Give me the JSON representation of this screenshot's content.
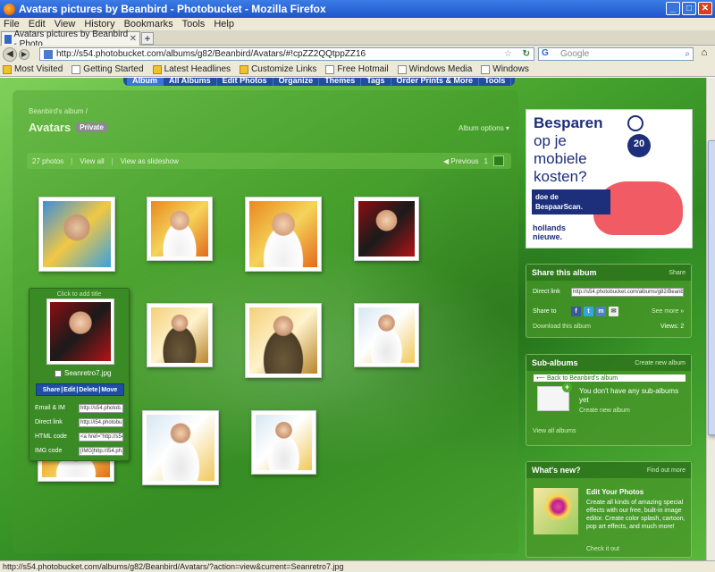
{
  "window": {
    "title": "Avatars pictures by Beanbird - Photobucket - Mozilla Firefox"
  },
  "menu": [
    "File",
    "Edit",
    "View",
    "History",
    "Bookmarks",
    "Tools",
    "Help"
  ],
  "tab": {
    "title": "Avatars pictures by Beanbird - Photo..."
  },
  "address": {
    "url": "http://s54.photobucket.com/albums/g82/Beanbird/Avatars/#!cpZZ2QQtppZZ16",
    "search_placeholder": "Google",
    "search_engine": "G"
  },
  "bookmarks": [
    "Most Visited",
    "Getting Started",
    "Latest Headlines",
    "Customize Links",
    "Free Hotmail",
    "Windows Media",
    "Windows"
  ],
  "site_nav": [
    "Album",
    "All Albums",
    "Edit Photos",
    "Organize",
    "Themes",
    "Tags",
    "Order Prints & More",
    "Tools"
  ],
  "album": {
    "breadcrumb": "Beanbird's album /",
    "title": "Avatars",
    "badge": "Private",
    "options": "Album options ▾",
    "count": "27 photos",
    "view_all": "View all",
    "slideshow": "View as slideshow",
    "previous": "◀ Previous",
    "page": "1"
  },
  "popup": {
    "add_title": "Click to add title",
    "filename": "Seanretro7.jpg",
    "actions": [
      "Share",
      "Edit",
      "Delete",
      "Move"
    ],
    "codes": [
      {
        "label": "Email & IM",
        "value": "http://s54.photob..."
      },
      {
        "label": "Direct link",
        "value": "http://i54.photobu..."
      },
      {
        "label": "HTML code",
        "value": "<a href=\"http://s54..."
      },
      {
        "label": "IMG code",
        "value": "[IMG]http://i54.ph..."
      }
    ]
  },
  "ad": {
    "line1": "Besparen",
    "line2": "op je",
    "line3": "mobiele",
    "line4": "kosten?",
    "badge": "20",
    "cta": "doe de BespaarScan.",
    "brand1": "hollands",
    "brand2": "nieuwe."
  },
  "share_box": {
    "title": "Share this album",
    "link": "Share",
    "direct_label": "Direct link",
    "direct_value": "http://s54.photobucket.com/albums/g82/Beanbird/",
    "share_to": "Share to",
    "see_more": "See more »",
    "download": "Download this album",
    "views": "Views: 2"
  },
  "subalbums": {
    "title": "Sub-albums",
    "link": "Create new album",
    "back": "Back to Beanbird's album",
    "empty": "You don't have any sub-albums yet",
    "create": "Create new album",
    "view_all": "View all albums"
  },
  "whatsnew": {
    "title": "What's new?",
    "link": "Find out more",
    "heading": "Edit Your Photos",
    "body": "Create all kinds of amazing special effects with our free, built-in image editor. Create color splash, cartoon, pop art effects, and much more!",
    "cta": "Check it out"
  },
  "status": {
    "text": "http://s54.photobucket.com/albums/g82/Beanbird/Avatars/?action=view&current=Seanretro7.jpg"
  },
  "colors": {
    "page_green": "#4aa62f",
    "nav_blue": "#1f4fa0",
    "ad_navy": "#1d2e7a",
    "ad_pink": "#f15b63"
  }
}
